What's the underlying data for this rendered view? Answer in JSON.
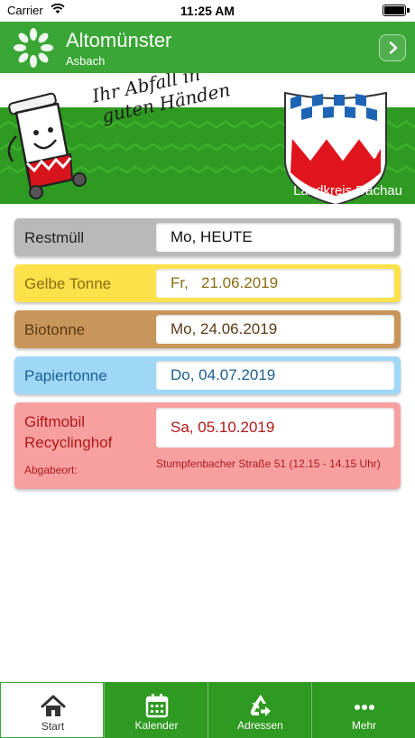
{
  "status_bar": {
    "carrier": "Carrier",
    "time": "11:25 AM"
  },
  "header": {
    "title": "Altomünster",
    "subtitle": "Asbach"
  },
  "banner": {
    "slogan_line1": "Ihr Abfall in",
    "slogan_line2": "guten Händen",
    "region": "Landkreis Dachau"
  },
  "bins": [
    {
      "label": "Restmüll",
      "date": "Mo, HEUTE"
    },
    {
      "label": "Gelbe Tonne",
      "date": "Fr,   21.06.2019"
    },
    {
      "label": "Biotonne",
      "date": "Mo, 24.06.2019"
    },
    {
      "label": "Papiertonne",
      "date": "Do, 04.07.2019"
    }
  ],
  "giftmobil": {
    "label_line1": "Giftmobil",
    "label_line2": "Recyclinghof",
    "date": "Sa, 05.10.2019",
    "place_label": "Abgabeort:",
    "place": "Stumpfenbacher Straße 51 (12.15 - 14.15 Uhr)"
  },
  "tabs": [
    {
      "label": "Start",
      "icon": "home-icon",
      "active": true
    },
    {
      "label": "Kalender",
      "icon": "calendar-icon",
      "active": false
    },
    {
      "label": "Adressen",
      "icon": "recycle-icon",
      "active": false
    },
    {
      "label": "Mehr",
      "icon": "more-icon",
      "active": false
    }
  ],
  "colors": {
    "brand_green": "#3aa635",
    "restmuell": "#b9b9b9",
    "gelbe_tonne": "#fde14a",
    "biotonne": "#c8955a",
    "papiertonne": "#9fd7f7",
    "giftmobil": "#f8a0a0"
  }
}
